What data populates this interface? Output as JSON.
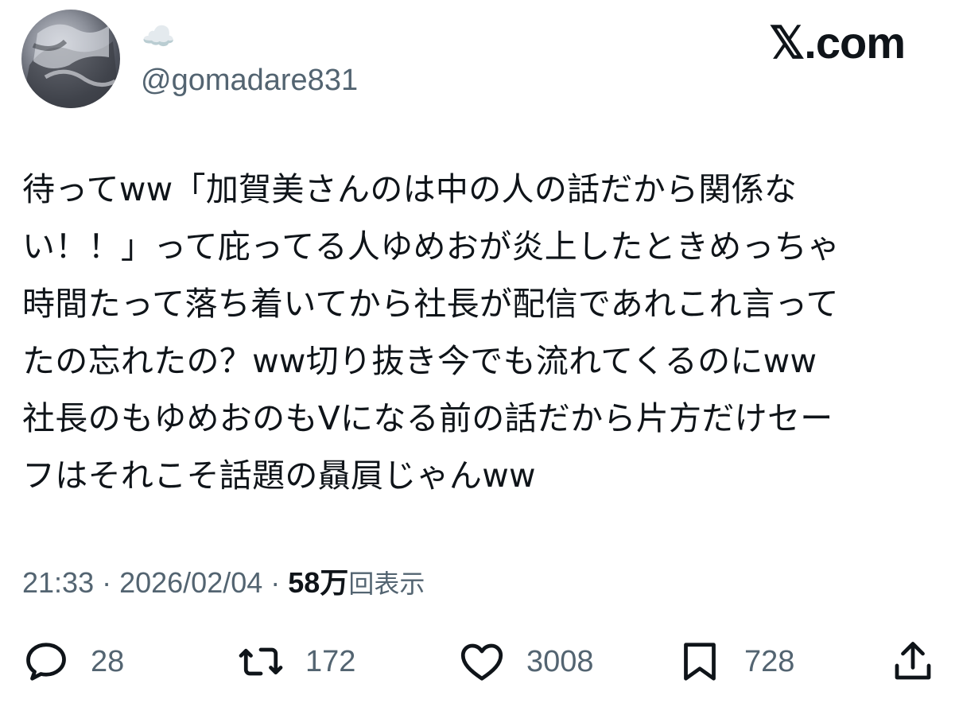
{
  "author": {
    "display_name": "☁️",
    "handle": "@gomadare831"
  },
  "brand": "𝕏.com",
  "tweet": {
    "text": "待ってww「加賀美さんのは中の人の話だから関係な\nい！！」って庇ってる人ゆめおが炎上したときめっちゃ\n時間たって落ち着いてから社長が配信であれこれ言って\nたの忘れたの？ww切り抜き今でも流れてくるのにww\n社長のもゆめおのもVになる前の話だから片方だけセー\nフはそれこそ話題の贔屓じゃんww"
  },
  "meta": {
    "time": "21:33",
    "separator": " · ",
    "date": "2026/02/04",
    "views_count": "58万",
    "views_label": "回表示"
  },
  "actions": {
    "replies": "28",
    "reposts": "172",
    "likes": "3008",
    "bookmarks": "728"
  },
  "icons": {
    "reply": "reply-icon",
    "repost": "repost-icon",
    "like": "heart-icon",
    "bookmark": "bookmark-icon",
    "share": "share-icon"
  },
  "colors": {
    "text": "#0f1419",
    "secondary": "#536471",
    "background": "#ffffff"
  }
}
